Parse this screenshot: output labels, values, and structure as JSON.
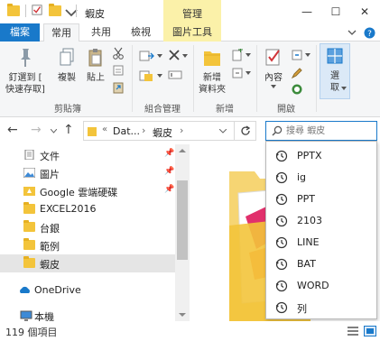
{
  "titlebar": {
    "title": "蝦皮",
    "context_tab_group": "管理",
    "minimize": "—",
    "maximize": "☐",
    "close": "✕"
  },
  "ribbon_tabs": {
    "file": "檔案",
    "home": "常用",
    "share": "共用",
    "view": "檢視",
    "picture_tools": "圖片工具",
    "collapse_icon": "chevron-down-icon",
    "help_icon": "help-icon"
  },
  "ribbon": {
    "pin": "釘選到 [\n快速存取]",
    "copy": "複製",
    "paste": "貼上",
    "clipboard_group": "剪貼簿",
    "organize_group": "組合管理",
    "new_folder": "新增\n資料夾",
    "new_group": "新增",
    "properties": "內容",
    "open_group": "開啟",
    "select": "選\n取"
  },
  "address": {
    "segment_1": "Dat...",
    "segment_2": "蝦皮",
    "search_placeholder": "搜尋 蝦皮"
  },
  "nav_pane": {
    "items": [
      {
        "label": "文件",
        "icon": "documents-icon",
        "pinned": true
      },
      {
        "label": "圖片",
        "icon": "pictures-icon",
        "pinned": true
      },
      {
        "label": "Google 雲端硬碟",
        "icon": "google-drive-icon",
        "pinned": true
      },
      {
        "label": "EXCEL2016",
        "icon": "folder-icon",
        "pinned": false
      },
      {
        "label": "台銀",
        "icon": "folder-icon",
        "pinned": false
      },
      {
        "label": "範例",
        "icon": "folder-icon",
        "pinned": false
      },
      {
        "label": "蝦皮",
        "icon": "folder-icon",
        "pinned": false
      },
      {
        "label": "OneDrive",
        "icon": "onedrive-icon",
        "pinned": false
      },
      {
        "label": "本機",
        "icon": "computer-icon",
        "pinned": false
      }
    ]
  },
  "search_suggestions": [
    "PPTX",
    "ig",
    "PPT",
    "2103",
    "LINE",
    "BAT",
    "WORD",
    "列"
  ],
  "statusbar": {
    "item_count": "119 個項目"
  },
  "colors": {
    "accent": "#1979ca",
    "folder": "#f3c43b",
    "context_tab": "#fbf1a9",
    "selected_row": "#e5e5e5"
  }
}
